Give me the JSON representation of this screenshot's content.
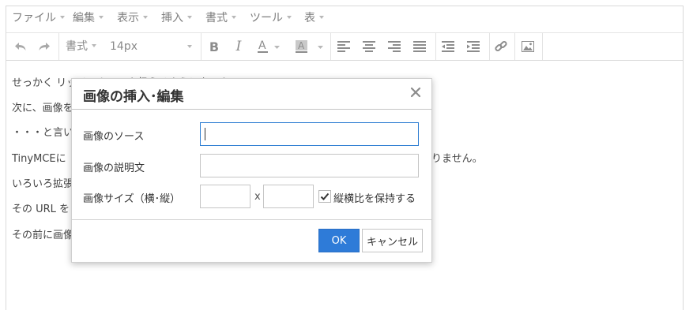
{
  "menubar": {
    "items": [
      {
        "label": "ファイル"
      },
      {
        "label": "編集"
      },
      {
        "label": "表示"
      },
      {
        "label": "挿入"
      },
      {
        "label": "書式"
      },
      {
        "label": "ツール"
      },
      {
        "label": "表"
      }
    ]
  },
  "toolbar": {
    "format_label": "書式",
    "font_size": "14px",
    "buttons": [
      "undo-icon",
      "redo-icon",
      "bold-icon",
      "italic-icon",
      "text-color-icon",
      "background-color-icon",
      "align-left-icon",
      "align-center-icon",
      "align-right-icon",
      "align-justify-icon",
      "outdent-icon",
      "indent-icon",
      "link-icon",
      "image-icon"
    ]
  },
  "content": {
    "paragraphs": [
      "せっかく リッチテキストを扱えるようになったので",
      "次に、画像を",
      "・・・と言いた",
      "TinyMCEに",
      "いろいろ拡張",
      "その URL を",
      "その前に画像"
    ],
    "para3_tail": "りません。"
  },
  "dialog": {
    "title": "画像の挿入･編集",
    "source_label": "画像のソース",
    "source_value": "",
    "description_label": "画像の説明文",
    "description_value": "",
    "size_label": "画像サイズ（横･縦）",
    "width_value": "",
    "height_value": "",
    "size_separator": "x",
    "keep_ratio_label": "縦横比を保持する",
    "keep_ratio_checked": true,
    "ok_label": "OK",
    "cancel_label": "キャンセル"
  },
  "colors": {
    "primary_button": "#2e7bd8",
    "focus_border": "#2d7dd2"
  }
}
